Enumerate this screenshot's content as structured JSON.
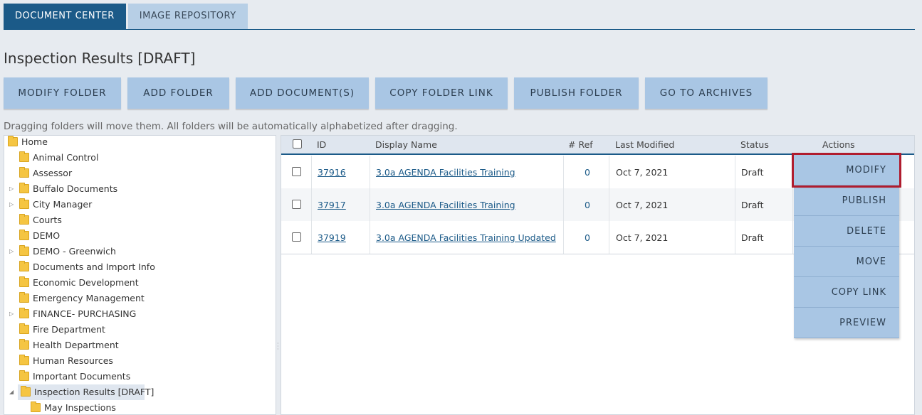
{
  "tabs": [
    "DOCUMENT CENTER",
    "IMAGE REPOSITORY"
  ],
  "page_title": "Inspection Results [DRAFT]",
  "toolbar": [
    "MODIFY FOLDER",
    "ADD FOLDER",
    "ADD DOCUMENT(S)",
    "COPY FOLDER LINK",
    "PUBLISH FOLDER",
    "GO TO ARCHIVES"
  ],
  "hint": "Dragging folders will move them. All folders will be automatically alphabetized after dragging.",
  "tree": {
    "root": "Home",
    "items": [
      "Animal Control",
      "Assessor",
      "Buffalo Documents",
      "City Manager",
      "Courts",
      "DEMO",
      "DEMO - Greenwich",
      "Documents and Import Info",
      "Economic Development",
      "Emergency Management",
      "FINANCE- PURCHASING",
      "Fire Department",
      "Health Department",
      "Human Resources",
      "Important Documents",
      "Inspection Results [DRAFT]"
    ],
    "child": "May Inspections"
  },
  "grid": {
    "headers": [
      "ID",
      "Display Name",
      "# Ref",
      "Last Modified",
      "Status",
      "Actions"
    ],
    "rows": [
      {
        "id": "37916",
        "name": "3.0a AGENDA Facilities Training",
        "ref": "0",
        "modified": "Oct 7, 2021",
        "status": "Draft"
      },
      {
        "id": "37917",
        "name": "3.0a AGENDA Facilities Training",
        "ref": "0",
        "modified": "Oct 7, 2021",
        "status": "Draft"
      },
      {
        "id": "37919",
        "name": "3.0a AGENDA Facilities Training Updated",
        "ref": "0",
        "modified": "Oct 7, 2021",
        "status": "Draft"
      }
    ]
  },
  "actions_menu": [
    "MODIFY",
    "PUBLISH",
    "DELETE",
    "MOVE",
    "COPY LINK",
    "PREVIEW"
  ],
  "colors": {
    "accent": "#1b5a88",
    "button": "#a9c6e4",
    "highlight": "#b01c2e",
    "folder": "#f5c542"
  }
}
